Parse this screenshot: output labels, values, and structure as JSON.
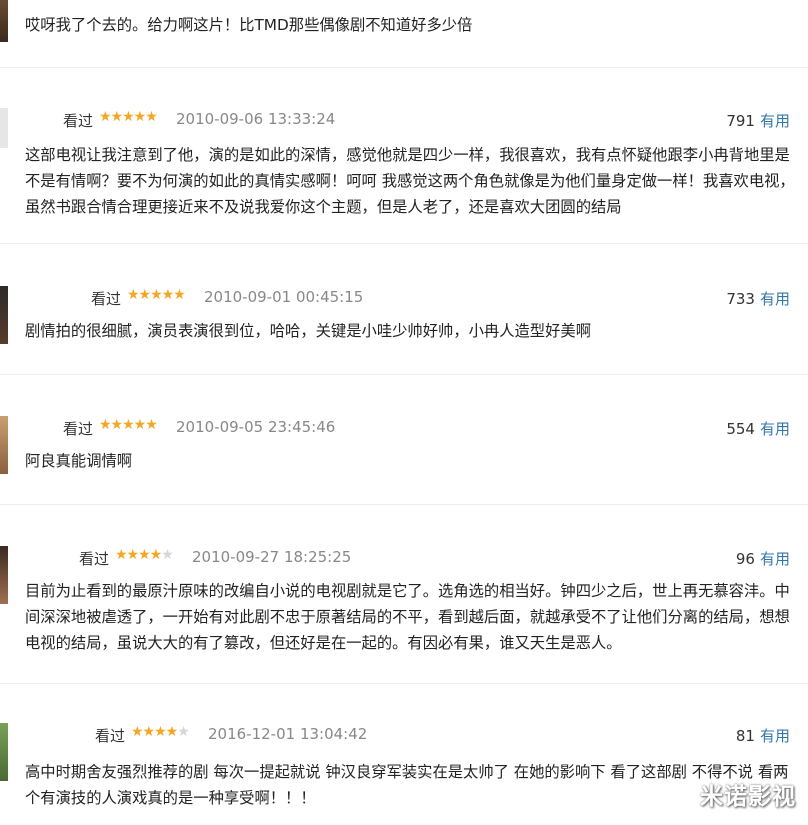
{
  "top_review": {
    "content": "哎呀我了个去的。给力啊这片！比TMD那些偶像剧不知道好多少倍"
  },
  "reviews": [
    {
      "watched": "看过",
      "stars": "★★★★★",
      "stars_empty": "",
      "rating": 5,
      "time": "2010-09-06 13:33:24",
      "votes": "791",
      "useful": "有用",
      "content": "这部电视让我注意到了他，演的是如此的深情，感觉他就是四少一样，我很喜欢，我有点怀疑他跟李小冉背地里是不是有情啊？要不为何演的如此的真情实感啊！呵呵 我感觉这两个角色就像是为他们量身定做一样！我喜欢电视，虽然书跟合情合理更接近来不及说我爱你这个主题，但是人老了，还是喜欢大团圆的结局"
    },
    {
      "watched": "看过",
      "stars": "★★★★★",
      "stars_empty": "",
      "rating": 5,
      "time": "2010-09-01 00:45:15",
      "votes": "733",
      "useful": "有用",
      "content": "剧情拍的很细腻，演员表演很到位，哈哈，关键是小哇少帅好帅，小冉人造型好美啊"
    },
    {
      "watched": "看过",
      "stars": "★★★★★",
      "stars_empty": "",
      "rating": 5,
      "time": "2010-09-05 23:45:46",
      "votes": "554",
      "useful": "有用",
      "content": "阿良真能调情啊"
    },
    {
      "watched": "看过",
      "stars": "★★★★",
      "stars_empty": "★",
      "rating": 4,
      "time": "2010-09-27 18:25:25",
      "votes": "96",
      "useful": "有用",
      "content": "目前为止看到的最原汁原味的改编自小说的电视剧就是它了。选角选的相当好。钟四少之后，世上再无慕容沣。中间深深地被虐透了，一开始有对此剧不忠于原著结局的不平，看到越后面，就越承受不了让他们分离的结局，想想电视的结局，虽说大大的有了篡改，但还好是在一起的。有因必有果，谁又天生是恶人。"
    },
    {
      "watched": "看过",
      "stars": "★★★★",
      "stars_empty": "★",
      "rating": 4,
      "time": "2016-12-01 13:04:42",
      "votes": "81",
      "useful": "有用",
      "content": "高中时期舍友强烈推荐的剧 每次一提起就说 钟汉良穿军装实在是太帅了 在她的影响下 看了这部剧 不得不说 看两个有演技的人演戏真的是一种享受啊！！！"
    }
  ],
  "watermark": "米诺影视",
  "colors": {
    "star": "#f5a623",
    "star_empty": "#d6d6d6",
    "useful_link": "#3377aa",
    "time": "#888888",
    "divider": "#ededed"
  }
}
